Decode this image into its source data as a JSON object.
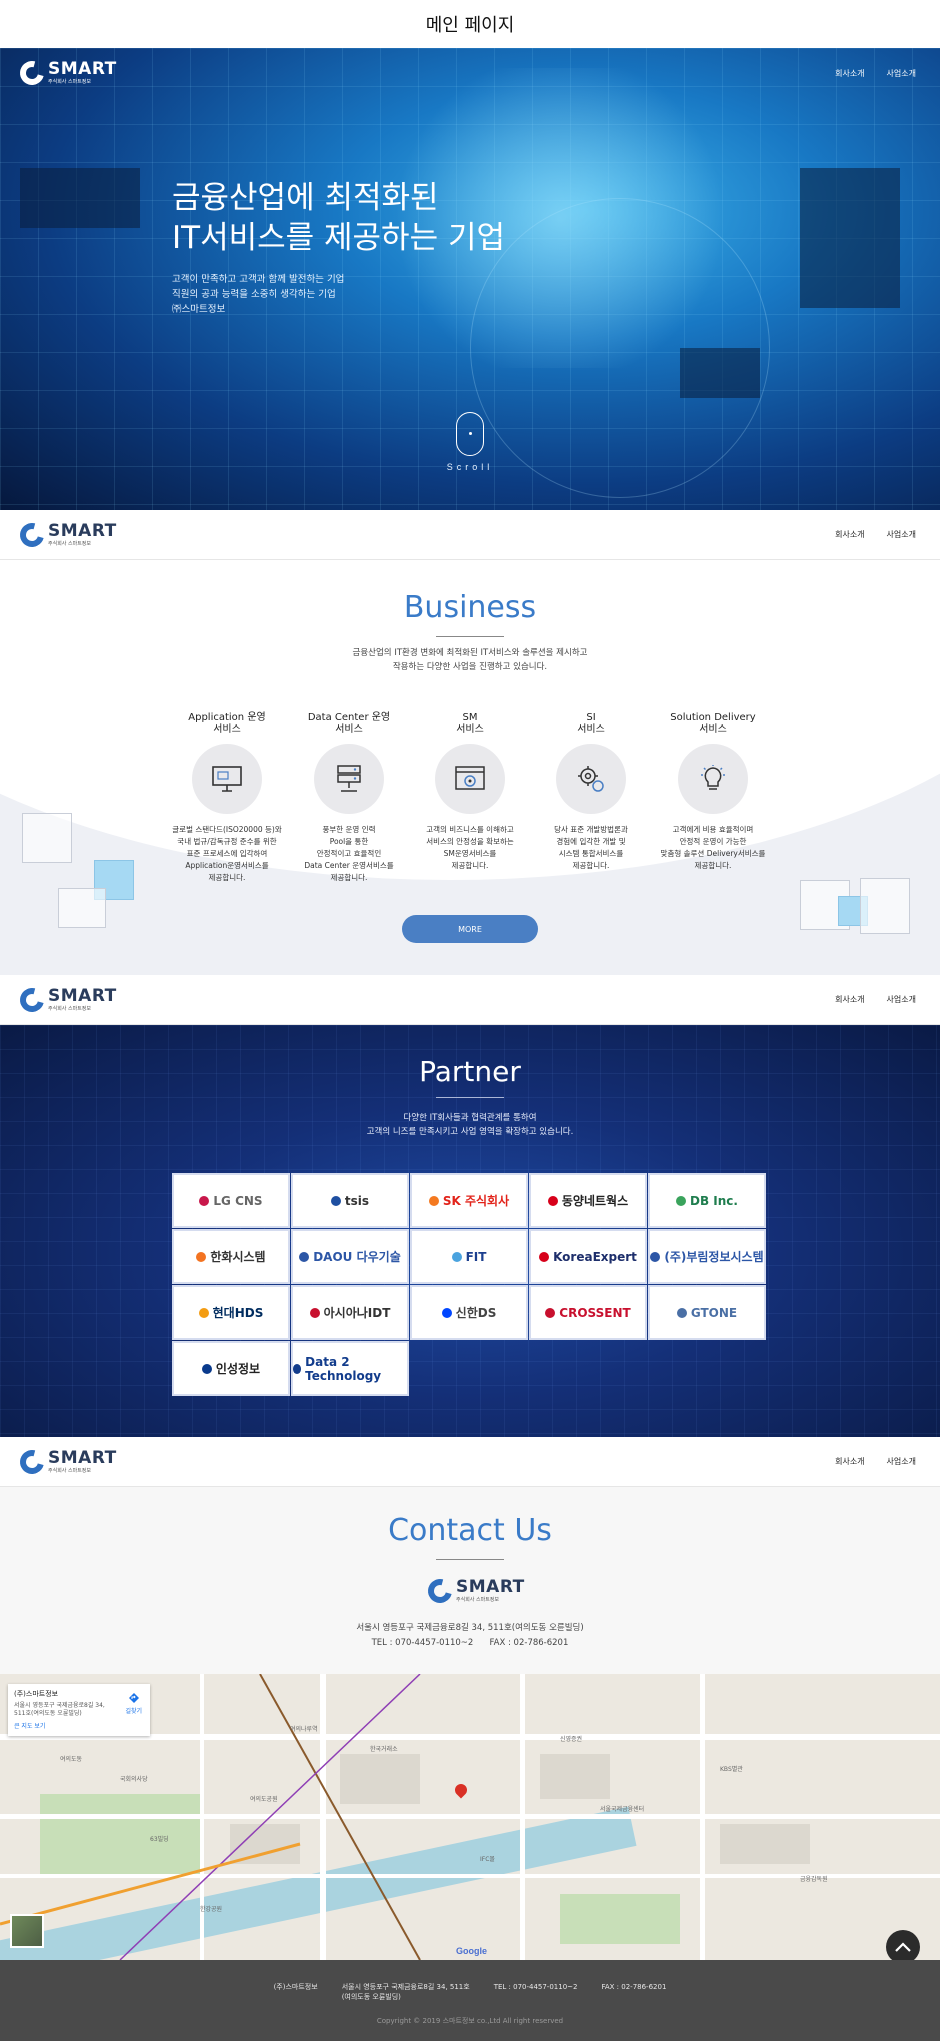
{
  "page": {
    "title": "메인 페이지"
  },
  "brand": {
    "name": "SMART",
    "sub": "주식회사 스마트정보"
  },
  "nav": {
    "items": [
      "회사소개",
      "사업소개"
    ]
  },
  "hero": {
    "headline": [
      "금융산업에 최적화된",
      "IT서비스를 제공하는 기업"
    ],
    "description": [
      "고객이 만족하고 고객과 함께 발전하는 기업",
      "직원의 공과 능력을 소중히 생각하는 기업",
      "㈜스마트정보"
    ],
    "scroll_label": "Scroll"
  },
  "business": {
    "heading": "Business",
    "description": [
      "금융산업의 IT환경 변화에 최적화된 IT서비스와 솔루션을 제시하고",
      "작용하는 다양한 사업을 진행하고 있습니다."
    ],
    "services": [
      {
        "title": [
          "Application 운영",
          "서비스"
        ],
        "icon": "monitor-icon",
        "desc": [
          "글로벌 스탠다드(ISO20000 등)와",
          "국내 법규/감독규정 준수를 위한",
          "표준 프로세스에 입각하여",
          "Application운영서비스를",
          "제공합니다."
        ]
      },
      {
        "title": [
          "Data Center 운영",
          "서비스"
        ],
        "icon": "server-icon",
        "desc": [
          "풍부한 운영 인력",
          "Pool을 통한",
          "안정적이고 효율적인",
          "Data Center 운영서비스를",
          "제공합니다."
        ]
      },
      {
        "title": [
          "SM",
          "서비스"
        ],
        "icon": "browser-gear-icon",
        "desc": [
          "고객의 비즈니스를 이해하고",
          "서비스의 안정성을 확보하는",
          "SM운영서비스를",
          "제공합니다."
        ]
      },
      {
        "title": [
          "SI",
          "서비스"
        ],
        "icon": "gears-icon",
        "desc": [
          "당사 표준 개발방법론과",
          "경험에 입각한 개발 및",
          "시스템 통합서비스를",
          "제공합니다."
        ]
      },
      {
        "title": [
          "Solution Delivery",
          "서비스"
        ],
        "icon": "lightbulb-icon",
        "desc": [
          "고객에게 비용 효율적이며",
          "안정적 운영이 가능한",
          "맞춤형 솔루션 Delivery서비스를",
          "제공합니다."
        ]
      }
    ],
    "more_label": "MORE"
  },
  "partner": {
    "heading": "Partner",
    "description": [
      "다양한 IT회사들과 협력관계를 통하여",
      "고객의 니즈를 만족시키고 사업 영역을 확장하고 있습니다."
    ],
    "logos": [
      {
        "name": "LG CNS",
        "color": "#666666",
        "mark": "#c8174b"
      },
      {
        "name": "tsis",
        "color": "#333333",
        "mark": "#1e4fa1"
      },
      {
        "name": "SK 주식회사",
        "color": "#e2231a",
        "mark": "#f47920"
      },
      {
        "name": "동양네트웍스",
        "color": "#222222",
        "mark": "#d7001a"
      },
      {
        "name": "DB Inc.",
        "color": "#1f7d4e",
        "mark": "#3aa35c"
      },
      {
        "name": "한화시스템",
        "color": "#333333",
        "mark": "#f37321"
      },
      {
        "name": "DAOU 다우기술",
        "color": "#2c56a6",
        "mark": "#2c56a6"
      },
      {
        "name": "FIT",
        "color": "#1c3f8f",
        "mark": "#4aa3df"
      },
      {
        "name": "KoreaExpert",
        "color": "#1d2e6b",
        "mark": "#d7001a"
      },
      {
        "name": "(주)부림정보시스템",
        "color": "#2c56a6",
        "mark": "#2c56a6"
      },
      {
        "name": "현대HDS",
        "color": "#002c5f",
        "mark": "#f39c12"
      },
      {
        "name": "아시아나IDT",
        "color": "#333333",
        "mark": "#c8102e"
      },
      {
        "name": "신한DS",
        "color": "#444444",
        "mark": "#0046ff"
      },
      {
        "name": "CROSSENT",
        "color": "#c8102e",
        "mark": "#c8102e"
      },
      {
        "name": "GTONE",
        "color": "#4a6fa5",
        "mark": "#4a6fa5"
      },
      {
        "name": "인성정보",
        "color": "#222222",
        "mark": "#0a3a8c"
      },
      {
        "name": "Data 2 Technology",
        "color": "#123c8c",
        "mark": "#123c8c"
      }
    ]
  },
  "contact": {
    "heading": "Contact Us",
    "address": "서울시 영등포구 국제금융로8길 34, 511호(여의도동 오륜빌딩)",
    "phone": "TEL : 070-4457-0110~2",
    "fax": "FAX : 02-786-6201"
  },
  "map": {
    "card_name": "(주)스마트정보",
    "card_address": "서울시 영등포구 국제금융로8길 34, 511호(여의도동 오륜빌딩)",
    "card_link": "큰 지도 보기",
    "card_directions": "길찾기",
    "google": "Google",
    "labels": [
      "여의도동",
      "국회의사당",
      "한국거래소",
      "여의도공원",
      "신영증권",
      "여의나루역",
      "서울국제금융센터",
      "KBS별관",
      "63빌딩",
      "한강공원",
      "금융감독원",
      "IFC몰"
    ]
  },
  "footer": {
    "company": "(주)스마트정보",
    "address": [
      "서울시 영등포구 국제금융로8길 34, 511호",
      "(여의도동 오륜빌딩)"
    ],
    "tel": "TEL : 070-4457-0110~2",
    "fax": "FAX : 02-786-6201",
    "copyright": "Copyright © 2019 스마트정보 co.,Ltd All right reserved"
  }
}
